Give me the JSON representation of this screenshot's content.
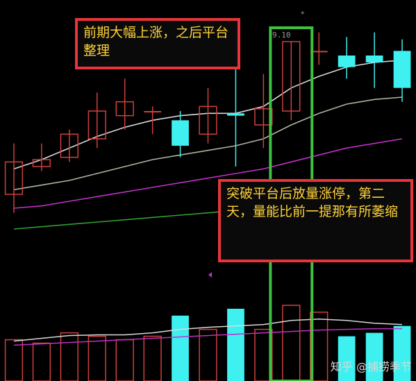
{
  "callouts": {
    "top": "前期大幅上涨，之后平台整理",
    "bottom": "突破平台后放量涨停，第二天，量能比前一提那有所萎缩"
  },
  "price_label": "9.10",
  "star_marker": "*",
  "watermark": "知乎 @捕捞季节",
  "colors": {
    "up": "#d24040",
    "down": "#3ff0f0",
    "ma_white": "#d8d8d8",
    "ma_light": "#a9b8a0",
    "ma_purple": "#c030c8",
    "ma_green": "#30a030",
    "highlight": "#3fc040",
    "callout_border": "#e8343a",
    "callout_text": "#ffd23a"
  },
  "chart_data": {
    "type": "candlestick",
    "title": "",
    "candles": [
      {
        "open": 6.8,
        "close": 7.5,
        "high": 7.9,
        "low": 6.4
      },
      {
        "open": 7.4,
        "close": 7.55,
        "high": 7.9,
        "low": 7.3
      },
      {
        "open": 7.6,
        "close": 8.1,
        "high": 8.2,
        "low": 7.5
      },
      {
        "open": 8.0,
        "close": 8.6,
        "high": 9.0,
        "low": 7.8
      },
      {
        "open": 8.5,
        "close": 8.8,
        "high": 9.3,
        "low": 8.2
      },
      {
        "open": 8.6,
        "close": 8.6,
        "high": 8.7,
        "low": 8.1
      },
      {
        "open": 8.4,
        "close": 7.85,
        "high": 8.6,
        "low": 7.6
      },
      {
        "open": 8.1,
        "close": 8.7,
        "high": 9.1,
        "low": 7.9
      },
      {
        "open": 8.55,
        "close": 8.5,
        "high": 9.9,
        "low": 7.4
      },
      {
        "open": 8.3,
        "close": 8.65,
        "high": 9.4,
        "low": 7.8
      },
      {
        "open": 8.6,
        "close": 10.1,
        "high": 10.1,
        "low": 8.4
      },
      {
        "open": 9.9,
        "close": 9.9,
        "high": 10.3,
        "low": 9.6
      },
      {
        "open": 9.8,
        "close": 9.55,
        "high": 10.2,
        "low": 9.3
      },
      {
        "open": 9.8,
        "close": 9.65,
        "high": 10.3,
        "low": 9.1
      },
      {
        "open": 9.9,
        "close": 9.1,
        "high": 10.15,
        "low": 8.8
      }
    ],
    "moving_averages": [
      {
        "color": "#d8d8d8",
        "values": [
          7.35,
          7.55,
          7.8,
          8.05,
          8.25,
          8.4,
          8.5,
          8.55,
          8.55,
          8.7,
          9.1,
          9.35,
          9.55,
          9.65,
          9.7
        ]
      },
      {
        "color": "#a9b8a0",
        "values": [
          6.9,
          7.0,
          7.1,
          7.25,
          7.4,
          7.55,
          7.65,
          7.75,
          7.85,
          8.0,
          8.3,
          8.55,
          8.75,
          8.85,
          8.9
        ]
      },
      {
        "color": "#c030c8",
        "values": [
          6.5,
          6.55,
          6.65,
          6.75,
          6.85,
          6.95,
          7.05,
          7.15,
          7.25,
          7.35,
          7.5,
          7.65,
          7.8,
          7.9,
          8.0
        ]
      },
      {
        "color": "#30a030",
        "values": [
          6.05,
          6.1,
          6.15,
          6.2,
          6.25,
          6.3,
          6.35,
          6.4,
          6.45,
          6.5,
          6.55,
          6.6,
          6.65,
          6.7,
          6.75
        ]
      }
    ],
    "volume": [
      {
        "value": 60,
        "up": true
      },
      {
        "value": 55,
        "up": true
      },
      {
        "value": 70,
        "up": true
      },
      {
        "value": 65,
        "up": true
      },
      {
        "value": 60,
        "up": true
      },
      {
        "value": 65,
        "up": true
      },
      {
        "value": 95,
        "up": false
      },
      {
        "value": 75,
        "up": true
      },
      {
        "value": 105,
        "up": false
      },
      {
        "value": 75,
        "up": true
      },
      {
        "value": 110,
        "up": true
      },
      {
        "value": 100,
        "up": true
      },
      {
        "value": 65,
        "up": false
      },
      {
        "value": 70,
        "up": false
      },
      {
        "value": 80,
        "up": false
      }
    ],
    "volume_ma": [
      {
        "color": "#d8d8d8",
        "values": [
          58,
          62,
          66,
          67,
          67,
          70,
          75,
          78,
          80,
          82,
          88,
          90,
          88,
          84,
          82
        ]
      },
      {
        "color": "#c030c8",
        "values": [
          52,
          54,
          56,
          58,
          60,
          62,
          64,
          66,
          68,
          70,
          72,
          74,
          75,
          76,
          76
        ]
      }
    ],
    "highlight_index": 10,
    "price_range": [
      5.0,
      10.7
    ],
    "volume_range": [
      0,
      120
    ]
  }
}
